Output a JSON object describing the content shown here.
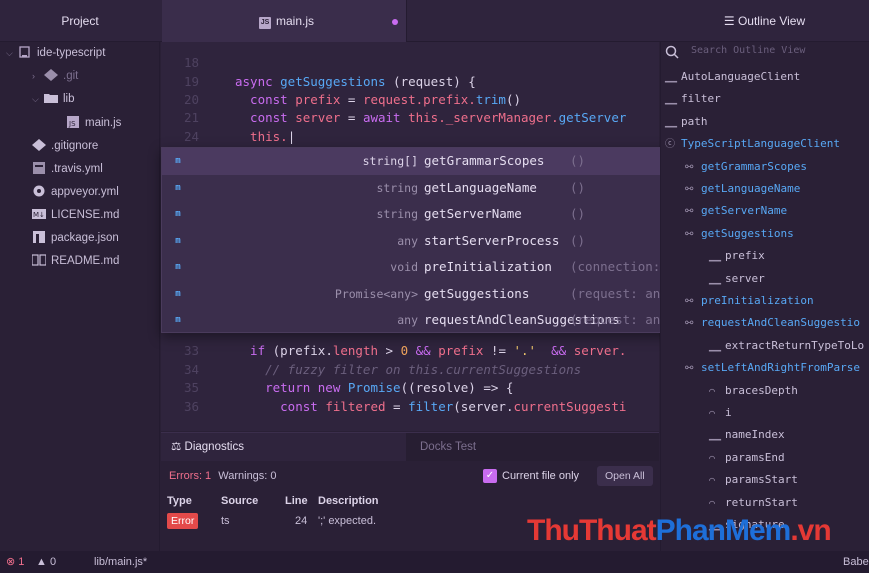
{
  "header": {
    "project_title": "Project",
    "tab_label": "main.js",
    "tab_icon_text": "JS",
    "outline_title": "☰ Outline View"
  },
  "tree": {
    "items": [
      {
        "label": "ide-typescript",
        "icon": "repo-icon"
      },
      {
        "label": ".git",
        "icon": "git-icon"
      },
      {
        "label": "lib",
        "icon": "folder-icon"
      },
      {
        "label": "main.js",
        "icon": "js-file-icon"
      },
      {
        "label": ".gitignore",
        "icon": "git-icon"
      },
      {
        "label": ".travis.yml",
        "icon": "travis-icon"
      },
      {
        "label": "appveyor.yml",
        "icon": "appveyor-icon"
      },
      {
        "label": "LICENSE.md",
        "icon": "markdown-icon"
      },
      {
        "label": "package.json",
        "icon": "npm-icon"
      },
      {
        "label": "README.md",
        "icon": "book-icon"
      }
    ]
  },
  "editor": {
    "lines": [
      {
        "n": "18"
      },
      {
        "n": "19"
      },
      {
        "n": "20"
      },
      {
        "n": "21"
      },
      {
        "n": "24"
      },
      {
        "n": "33"
      },
      {
        "n": "34"
      },
      {
        "n": "35"
      },
      {
        "n": "36"
      }
    ],
    "code": {
      "l19_a": "async ",
      "l19_b": "getSuggestions",
      "l19_c": " (request) {",
      "l20_a": "  const ",
      "l20_b": "prefix",
      "l20_c": " = ",
      "l20_d": "request.prefix.",
      "l20_e": "trim",
      "l20_f": "()",
      "l21_a": "  const ",
      "l21_b": "server",
      "l21_c": " = ",
      "l21_d": "await ",
      "l21_e": "this.",
      "l21_f": "_serverManager.",
      "l21_g": "getServer",
      "l24_a": "  this.",
      "l33_a": "  if ",
      "l33_b": "(prefix.",
      "l33_c": "length",
      "l33_d": " > ",
      "l33_e": "0",
      "l33_f": " && ",
      "l33_g": "prefix",
      "l33_h": " != ",
      "l33_i": "'.'",
      "l33_j": "  && ",
      "l33_k": "server.",
      "l34_a": "    // fuzzy filter on this.currentSuggestions",
      "l35_a": "    return new ",
      "l35_b": "Promise",
      "l35_c": "((resolve) => {",
      "l36_a": "      const ",
      "l36_b": "filtered",
      "l36_c": " = ",
      "l36_d": "filter",
      "l36_e": "(server.",
      "l36_f": "currentSuggesti"
    }
  },
  "autocomplete": {
    "items": [
      {
        "badge": "m",
        "type": "string[]",
        "name": "getGrammarScopes",
        "sig": "()"
      },
      {
        "badge": "m",
        "type": "string",
        "name": "getLanguageName",
        "sig": "()"
      },
      {
        "badge": "m",
        "type": "string",
        "name": "getServerName",
        "sig": "()"
      },
      {
        "badge": "m",
        "type": "any",
        "name": "startServerProcess",
        "sig": "()"
      },
      {
        "badge": "m",
        "type": "void",
        "name": "preInitialization",
        "sig": "(connection: an"
      },
      {
        "badge": "m",
        "type": "Promise<any>",
        "name": "getSuggestions",
        "sig": "(request: any)"
      },
      {
        "badge": "m",
        "type": "any",
        "name": "requestAndCleanSuggestions",
        "sig": "(request: any)"
      }
    ]
  },
  "diagnostics": {
    "tab_active": "Diagnostics",
    "tab_other": "Docks Test",
    "errors": "Errors: 1",
    "warnings": "Warnings: 0",
    "current_file_only": "Current file only",
    "open_all": "Open All",
    "columns": {
      "type": "Type",
      "source": "Source",
      "line": "Line",
      "description": "Description"
    },
    "row": {
      "type": "Error",
      "source": "ts",
      "line": "24",
      "description": "';' expected."
    }
  },
  "outline": {
    "search_placeholder": "Search Outline View",
    "items": [
      {
        "label": "AutoLanguageClient",
        "icon": "field-icon"
      },
      {
        "label": "filter",
        "icon": "field-icon"
      },
      {
        "label": "path",
        "icon": "field-icon"
      },
      {
        "label": "TypeScriptLanguageClient",
        "icon": "class-icon"
      },
      {
        "label": "getGrammarScopes",
        "icon": "method-icon"
      },
      {
        "label": "getLanguageName",
        "icon": "method-icon"
      },
      {
        "label": "getServerName",
        "icon": "method-icon"
      },
      {
        "label": "getSuggestions",
        "icon": "method-icon"
      },
      {
        "label": "prefix",
        "icon": "field-icon"
      },
      {
        "label": "server",
        "icon": "field-icon"
      },
      {
        "label": "preInitialization",
        "icon": "method-icon"
      },
      {
        "label": "requestAndCleanSuggestio",
        "icon": "method-icon"
      },
      {
        "label": "extractReturnTypeToLo",
        "icon": "field-icon"
      },
      {
        "label": "setLeftAndRightFromParse",
        "icon": "method-icon"
      },
      {
        "label": "bracesDepth",
        "icon": "variable-icon"
      },
      {
        "label": "i",
        "icon": "variable-icon"
      },
      {
        "label": "nameIndex",
        "icon": "field-icon"
      },
      {
        "label": "paramsEnd",
        "icon": "variable-icon"
      },
      {
        "label": "paramsStart",
        "icon": "variable-icon"
      },
      {
        "label": "returnStart",
        "icon": "variable-icon"
      },
      {
        "label": "signature",
        "icon": "field-icon"
      }
    ]
  },
  "status": {
    "errors": "1",
    "warnings": "0",
    "file": "lib/main.js*",
    "grammar": "Babe"
  },
  "watermark": {
    "part1": "ThuThuat",
    "part2": "PhanMem",
    "part3": ".vn"
  },
  "colors": {
    "accent": "#c96cf0",
    "link": "#58a8f5",
    "error": "#e34a4a",
    "background": "#2a2036"
  }
}
